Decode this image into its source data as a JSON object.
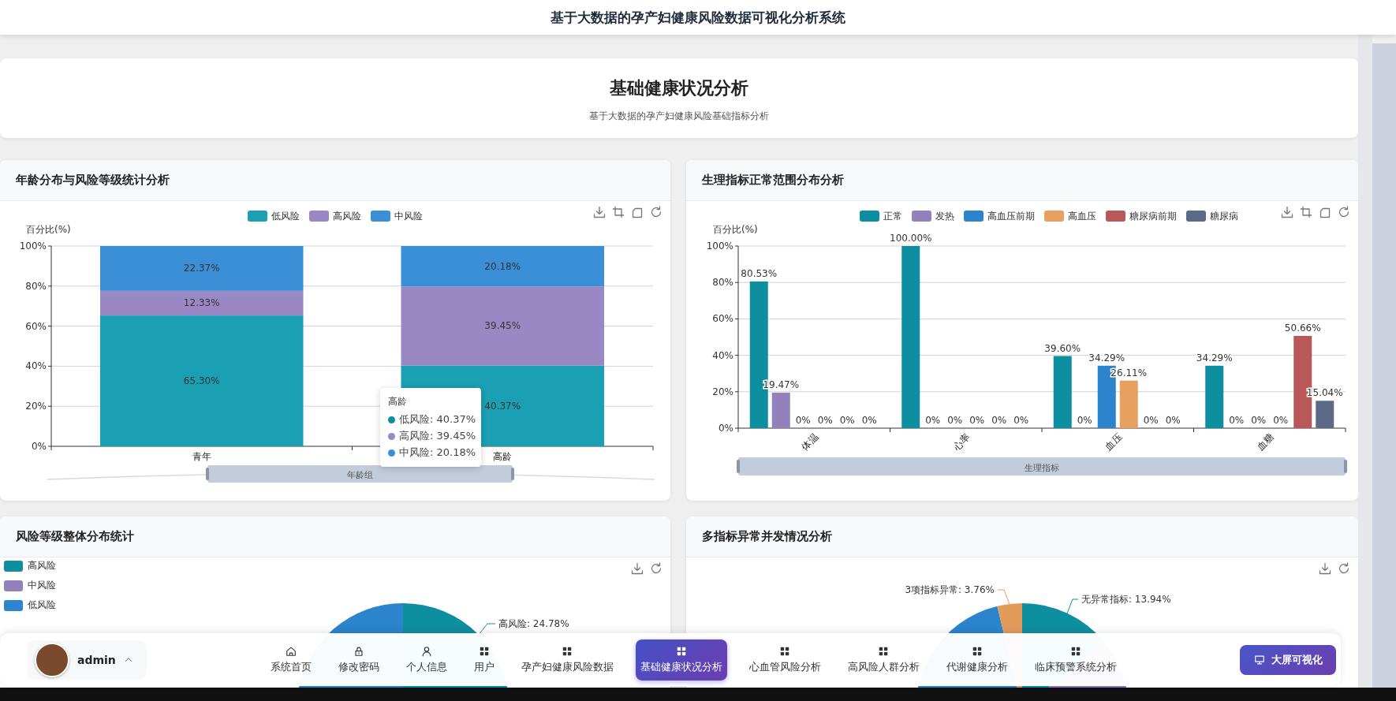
{
  "header": {
    "title": "基于大数据的孕产妇健康风险数据可视化分析系统"
  },
  "hero": {
    "title": "基础健康状况分析",
    "subtitle": "基于大数据的孕产妇健康风险基础指标分析"
  },
  "panels": [
    {
      "kind": "chart",
      "title": "年龄分布与风险等级统计分析",
      "chart_data": {
        "type": "bar",
        "stacked": true,
        "grid": true,
        "legend": true,
        "ylabel": "百分比(%)",
        "xlabel": "年龄组",
        "categories": [
          "青年",
          "高龄"
        ],
        "series": [
          {
            "name": "低风险",
            "color": "#1a9fb3",
            "values": [
              65.3,
              40.37
            ]
          },
          {
            "name": "高风险",
            "color": "#9a88c4",
            "values": [
              12.33,
              39.45
            ]
          },
          {
            "name": "中风险",
            "color": "#3a8fd6",
            "values": [
              22.37,
              20.18
            ]
          }
        ],
        "ylim": [
          0,
          100
        ],
        "yticks": [
          {
            "value": 0,
            "label": "0%"
          },
          {
            "value": 20,
            "label": "20%"
          },
          {
            "value": 40,
            "label": "40%"
          },
          {
            "value": 60,
            "label": "60%"
          },
          {
            "value": 80,
            "label": "80%"
          },
          {
            "value": 100,
            "label": "100%"
          }
        ],
        "value_labels": [
          [
            "65.30%",
            "40.37%"
          ],
          [
            "12.33%",
            "39.45%"
          ],
          [
            "22.37%",
            "20.18%"
          ]
        ]
      },
      "tooltip": {
        "title": "高龄",
        "rows": [
          {
            "text": "低风险: 40.37%",
            "color": "#0e8fa0"
          },
          {
            "text": "高风险: 39.45%",
            "color": "#9a88c4"
          },
          {
            "text": "中风险: 20.18%",
            "color": "#3a8fd6"
          }
        ]
      }
    },
    {
      "kind": "chart",
      "title": "生理指标正常范围分布分析",
      "chart_data": {
        "type": "bar",
        "stacked": false,
        "grid": true,
        "legend": true,
        "ylabel": "百分比(%)",
        "xlabel": "生理指标",
        "categories": [
          "体温",
          "心率",
          "血压",
          "血糖"
        ],
        "series": [
          {
            "name": "正常",
            "color": "#0e8fa0",
            "values": [
              80.53,
              100.0,
              39.6,
              34.29
            ]
          },
          {
            "name": "发热",
            "color": "#9381bb",
            "values": [
              19.47,
              0,
              0,
              0
            ]
          },
          {
            "name": "高血压前期",
            "color": "#2c84cc",
            "values": [
              0,
              0,
              34.29,
              0
            ]
          },
          {
            "name": "高血压",
            "color": "#e8a060",
            "values": [
              0,
              0,
              26.11,
              0
            ]
          },
          {
            "name": "糖尿病前期",
            "color": "#b85858",
            "values": [
              0,
              0,
              0,
              50.66
            ]
          },
          {
            "name": "糖尿病",
            "color": "#5c6a88",
            "values": [
              0,
              0,
              0,
              15.04
            ]
          }
        ],
        "ylim": [
          0,
          100
        ],
        "yticks": [
          {
            "value": 0,
            "label": "0%"
          },
          {
            "value": 20,
            "label": "20%"
          },
          {
            "value": 40,
            "label": "40%"
          },
          {
            "value": 60,
            "label": "60%"
          },
          {
            "value": 80,
            "label": "80%"
          },
          {
            "value": 100,
            "label": "100%"
          }
        ],
        "value_labels": [
          [
            "80.53%",
            "100.00%",
            "39.60%",
            "34.29%"
          ],
          [
            "19.47%",
            "0%",
            "0%",
            "0%"
          ],
          [
            "0%",
            "0%",
            "34.29%",
            "0%"
          ],
          [
            "0%",
            "0%",
            "26.11%",
            "0%"
          ],
          [
            "0%",
            "0%",
            "0%",
            "50.66%"
          ],
          [
            "0%",
            "0%",
            "0%",
            "15.04%"
          ]
        ]
      }
    },
    {
      "kind": "pie",
      "title": "风险等级整体分布统计",
      "legend": [
        {
          "label": "高风险",
          "color": "#0e8fa0"
        },
        {
          "label": "中风险",
          "color": "#9381bb"
        },
        {
          "label": "低风险",
          "color": "#2c84cc"
        }
      ],
      "pie_labels": [
        "高风险: 24.78%"
      ]
    },
    {
      "kind": "pie",
      "title": "多指标异常并发情况分析",
      "pie_labels": [
        "3项指标异常: 3.76%",
        "无异常指标: 13.94%"
      ]
    }
  ],
  "dock": {
    "user": {
      "name": "admin"
    },
    "items": [
      {
        "label": "系统首页",
        "kind": "home",
        "selected": false
      },
      {
        "label": "修改密码",
        "kind": "lock",
        "selected": false
      },
      {
        "label": "个人信息",
        "kind": "user",
        "selected": false
      },
      {
        "label": "用户",
        "kind": "grid",
        "selected": false
      },
      {
        "label": "孕产妇健康风险数据",
        "kind": "grid",
        "selected": false
      },
      {
        "label": "基础健康状况分析",
        "kind": "grid",
        "selected": true
      },
      {
        "label": "心血管风险分析",
        "kind": "grid",
        "selected": false
      },
      {
        "label": "高风险人群分析",
        "kind": "grid",
        "selected": false
      },
      {
        "label": "代谢健康分析",
        "kind": "grid",
        "selected": false
      },
      {
        "label": "临床预警系统分析",
        "kind": "grid",
        "selected": false
      }
    ],
    "action": {
      "label": "大屏可视化"
    }
  }
}
